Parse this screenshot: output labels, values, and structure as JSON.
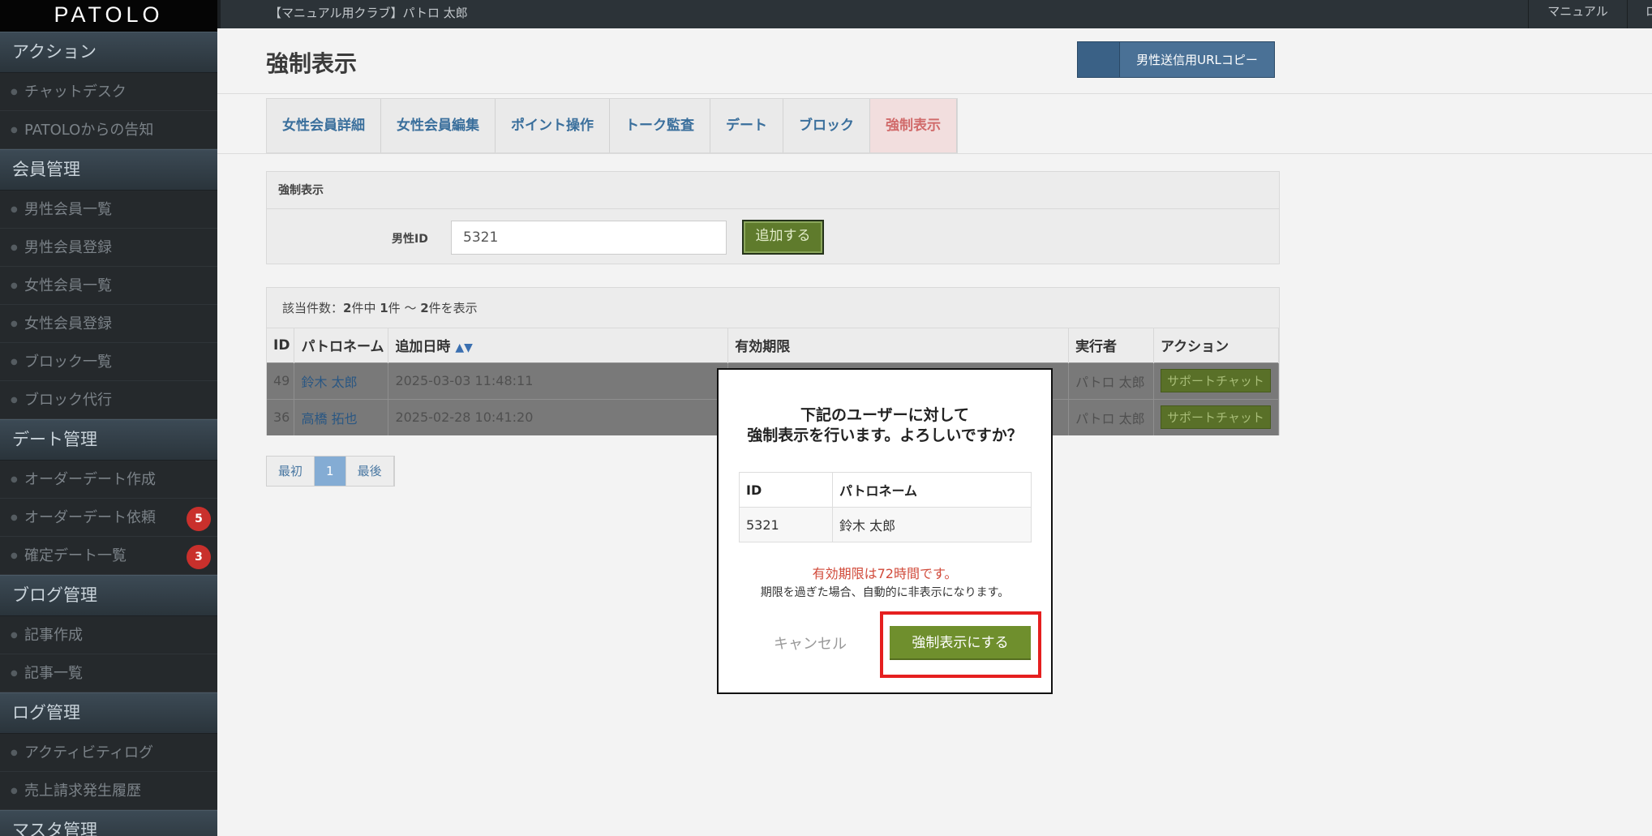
{
  "app": {
    "logo": "PATOLO",
    "club_label": "【マニュアル用クラブ】パトロ 太郎",
    "top_manual": "マニュアル",
    "top_right": "ロ"
  },
  "sidebar": {
    "sections": [
      {
        "title": "アクション",
        "items": [
          {
            "label": "チャットデスク",
            "badge": ""
          },
          {
            "label": "PATOLOからの告知",
            "badge": ""
          }
        ]
      },
      {
        "title": "会員管理",
        "items": [
          {
            "label": "男性会員一覧",
            "badge": ""
          },
          {
            "label": "男性会員登録",
            "badge": ""
          },
          {
            "label": "女性会員一覧",
            "badge": ""
          },
          {
            "label": "女性会員登録",
            "badge": ""
          },
          {
            "label": "ブロック一覧",
            "badge": ""
          },
          {
            "label": "ブロック代行",
            "badge": ""
          }
        ]
      },
      {
        "title": "デート管理",
        "items": [
          {
            "label": "オーダーデート作成",
            "badge": ""
          },
          {
            "label": "オーダーデート依頼",
            "badge": "5"
          },
          {
            "label": "確定デート一覧",
            "badge": "3"
          }
        ]
      },
      {
        "title": "ブログ管理",
        "items": [
          {
            "label": "記事作成",
            "badge": ""
          },
          {
            "label": "記事一覧",
            "badge": ""
          }
        ]
      },
      {
        "title": "ログ管理",
        "items": [
          {
            "label": "アクティビティログ",
            "badge": ""
          },
          {
            "label": "売上請求発生履歴",
            "badge": ""
          }
        ]
      },
      {
        "title": "マスタ管理",
        "items": []
      }
    ]
  },
  "main": {
    "page_title": "強制表示",
    "copy_url_button": "男性送信用URLコピー",
    "tabs": [
      {
        "label": "女性会員詳細"
      },
      {
        "label": "女性会員編集"
      },
      {
        "label": "ポイント操作"
      },
      {
        "label": "トーク監査"
      },
      {
        "label": "デート"
      },
      {
        "label": "ブロック"
      },
      {
        "label": "強制表示"
      }
    ],
    "panel": {
      "heading": "強制表示",
      "male_id_label": "男性ID",
      "male_id_value": "5321",
      "add_button": "追加する"
    },
    "results": {
      "count_prefix": "該当件数：",
      "total": "2",
      "count_mid1": "件中 ",
      "from": "1",
      "count_mid2": "件 ～ ",
      "to": "2",
      "count_suffix": "件を表示",
      "columns": [
        "ID",
        "パトロネーム",
        "追加日時",
        "有効期限",
        "実行者",
        "アクション"
      ],
      "sort_arrows": "▲▼",
      "rows": [
        {
          "id": "49",
          "name": "鈴木 太郎",
          "added": "2025-03-03 11:48:11",
          "expires": "",
          "executor": "パトロ 太郎",
          "action": "サポートチャット"
        },
        {
          "id": "36",
          "name": "高橋 拓也",
          "added": "2025-02-28 10:41:20",
          "expires": "",
          "executor": "パトロ 太郎",
          "action": "サポートチャット"
        }
      ]
    },
    "pager": {
      "first": "最初",
      "current": "1",
      "last": "最後"
    }
  },
  "modal": {
    "title_line1": "下記のユーザーに対して",
    "title_line2": "強制表示を行います。よろしいですか？",
    "table_headers": [
      "ID",
      "パトロネーム"
    ],
    "table_row": {
      "id": "5321",
      "name": "鈴木 太郎"
    },
    "warning": "有効期限は72時間です。",
    "note": "期限を過ぎた場合、自動的に非表示になります。",
    "cancel": "キャンセル",
    "confirm": "強制表示にする"
  }
}
